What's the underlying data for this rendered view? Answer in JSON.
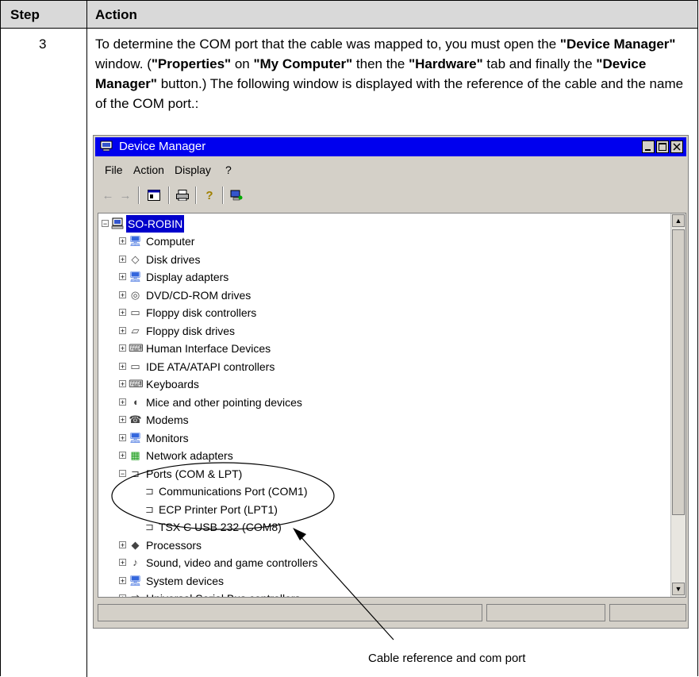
{
  "table": {
    "header_step": "Step",
    "header_action": "Action",
    "step_number": "3"
  },
  "paragraph": {
    "t1": "To determine the COM port that the cable was mapped to, you must open the ",
    "b1": "\"Device Manager\"",
    "t2": " window. (",
    "b2": "\"Properties\"",
    "t3": " on ",
    "b3": "\"My Computer\"",
    "t4": " then the ",
    "b4": "\"Hardware\"",
    "t5": " tab and finally the ",
    "b5": "\"Device Manager\"",
    "t6": " button.) The following window is displayed with the reference of the cable and the name of the COM port.:"
  },
  "window": {
    "title": "Device Manager",
    "menu": [
      "File",
      "Action",
      "Display",
      "?"
    ],
    "tree_root": "SO-ROBIN",
    "tree_items": [
      {
        "label": "Computer",
        "icon": "computer-icon",
        "glyph": "🖥"
      },
      {
        "label": "Disk drives",
        "icon": "disk-drive-icon",
        "glyph": "◇"
      },
      {
        "label": "Display adapters",
        "icon": "display-adapter-icon",
        "glyph": "🖥"
      },
      {
        "label": "DVD/CD-ROM drives",
        "icon": "cd-drive-icon",
        "glyph": "◎"
      },
      {
        "label": "Floppy disk controllers",
        "icon": "floppy-controller-icon",
        "glyph": "▭"
      },
      {
        "label": "Floppy disk drives",
        "icon": "floppy-drive-icon",
        "glyph": "▱"
      },
      {
        "label": "Human Interface Devices",
        "icon": "hid-icon",
        "glyph": "⌨"
      },
      {
        "label": "IDE ATA/ATAPI controllers",
        "icon": "ide-controller-icon",
        "glyph": "▭"
      },
      {
        "label": "Keyboards",
        "icon": "keyboard-icon",
        "glyph": "⌨"
      },
      {
        "label": "Mice and other pointing devices",
        "icon": "mouse-icon",
        "glyph": "◖"
      },
      {
        "label": "Modems",
        "icon": "modem-icon",
        "glyph": "☎"
      },
      {
        "label": "Monitors",
        "icon": "monitor-icon",
        "glyph": "🖥"
      },
      {
        "label": "Network adapters",
        "icon": "network-adapter-icon",
        "glyph": "▦"
      },
      {
        "label": "Ports (COM & LPT)",
        "icon": "port-icon",
        "glyph": "⊐"
      },
      {
        "label": "Communications Port (COM1)",
        "icon": "port-icon",
        "glyph": "⊐"
      },
      {
        "label": "ECP Printer Port (LPT1)",
        "icon": "port-icon",
        "glyph": "⊐"
      },
      {
        "label": "TSX C USB 232 (COM8)",
        "icon": "port-icon",
        "glyph": "⊐"
      },
      {
        "label": "Processors",
        "icon": "processor-icon",
        "glyph": "◆"
      },
      {
        "label": "Sound, video and game controllers",
        "icon": "sound-icon",
        "glyph": "♪"
      },
      {
        "label": "System devices",
        "icon": "system-device-icon",
        "glyph": "🖥"
      },
      {
        "label": "Universal Serial Bus controllers",
        "icon": "usb-icon",
        "glyph": "⇄"
      }
    ]
  },
  "annotation": {
    "caption": "Cable reference and com port"
  },
  "colors": {
    "header_bg": "#d9d9d9",
    "titlebar": "#0000ee",
    "selection": "#0000cc"
  }
}
